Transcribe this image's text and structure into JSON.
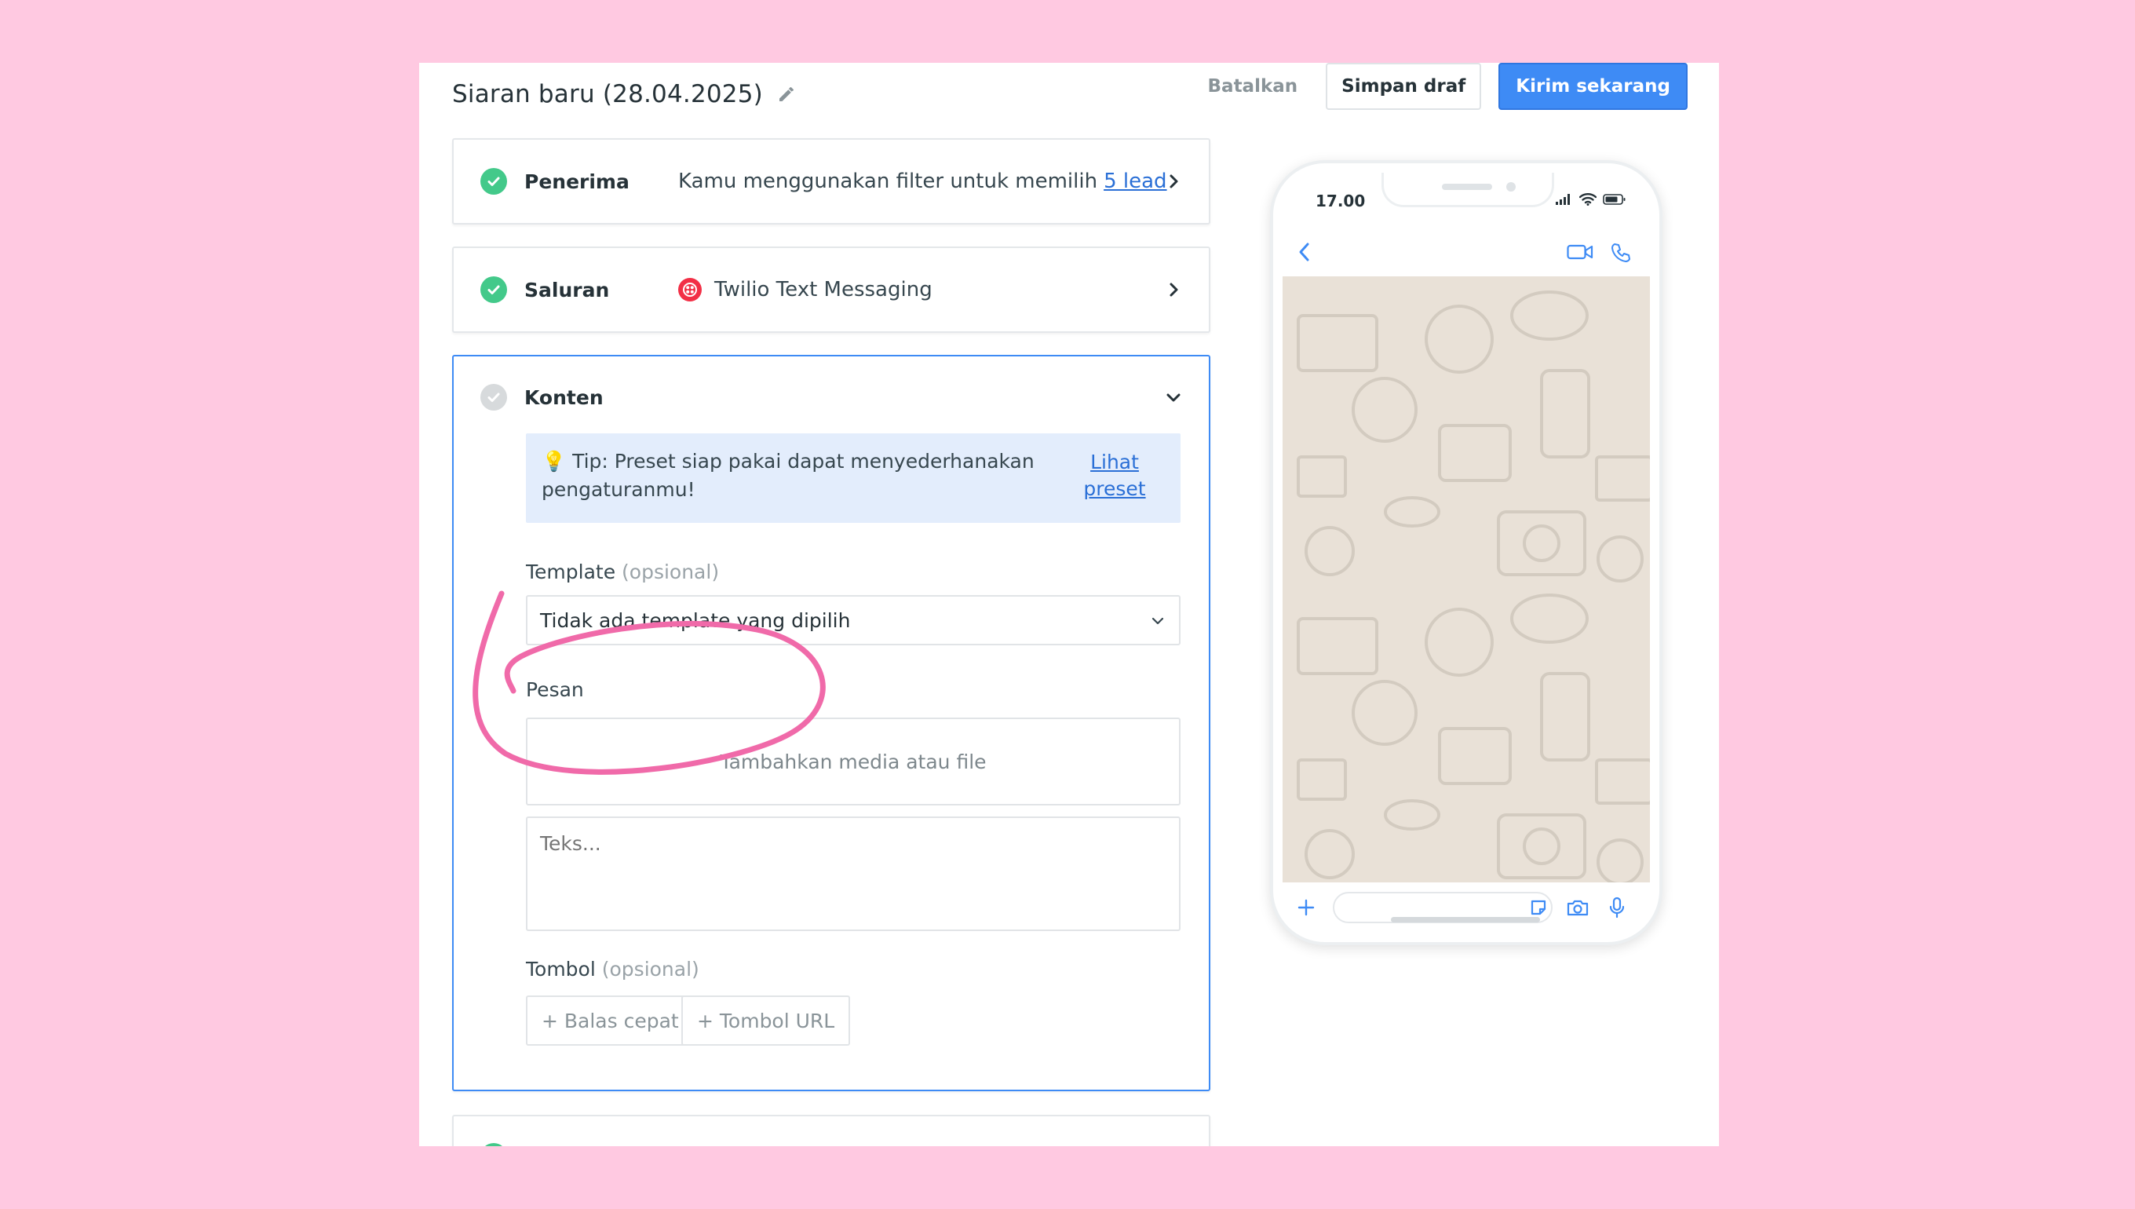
{
  "header": {
    "title": "Siaran baru (28.04.2025)",
    "cancel_label": "Batalkan",
    "save_draft_label": "Simpan draf",
    "send_now_label": "Kirim sekarang"
  },
  "steps": {
    "recipients": {
      "name": "Penerima",
      "summary": "Kamu menggunakan filter untuk memilih",
      "link": "5 lead",
      "status": "complete"
    },
    "channel": {
      "name": "Saluran",
      "summary": "Twilio Text Messaging",
      "icon": "twilio-icon",
      "status": "complete"
    },
    "content": {
      "name": "Konten",
      "status": "incomplete",
      "tip": {
        "text": "💡 Tip: Preset siap pakai dapat menyederhanakan pengaturanmu!",
        "link": "Lihat preset"
      },
      "template": {
        "label": "Template",
        "optional": "(opsional)",
        "value": "Tidak ada template yang dipilih"
      },
      "message": {
        "label": "Pesan",
        "media_label": "Tambahkan media atau file",
        "text_placeholder": "Teks..."
      },
      "buttons": {
        "label": "Tombol",
        "optional": "(opsional)",
        "quick_reply": "+ Balas cepat",
        "url_button": "+ Tombol URL"
      }
    }
  },
  "phone_preview": {
    "time": "17.00",
    "icons": [
      "signal-icon",
      "wifi-icon",
      "battery-icon",
      "back-icon",
      "video-icon",
      "phone-call-icon",
      "plus-icon",
      "sticker-icon",
      "camera-icon",
      "mic-icon"
    ]
  },
  "colors": {
    "page_background": "#ffc9e1",
    "primary": "#3e8bf5",
    "success": "#43c98a",
    "annotation": "#f06aa9",
    "tip_background": "#e3edfc",
    "chat_background": "#e9e1d7"
  }
}
